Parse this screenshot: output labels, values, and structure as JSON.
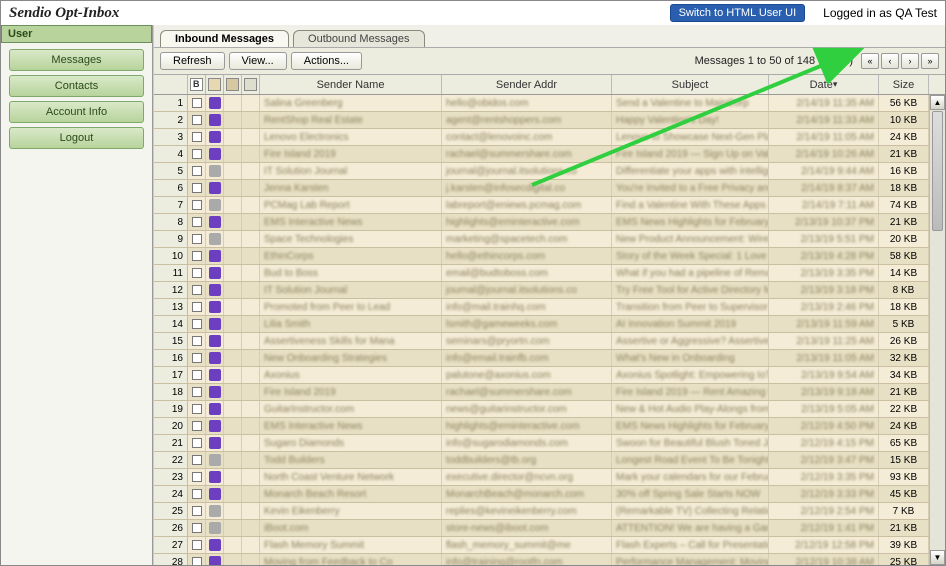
{
  "header": {
    "title": "Sendio Opt-Inbox",
    "switch_label": "Switch to HTML User UI",
    "logged_label": "Logged in as QA Test"
  },
  "sidebar": {
    "title": "User",
    "items": [
      "Messages",
      "Contacts",
      "Account Info",
      "Logout"
    ]
  },
  "tabs": {
    "items": [
      {
        "label": "Inbound Messages",
        "active": true
      },
      {
        "label": "Outbound Messages",
        "active": false
      }
    ]
  },
  "toolbar": {
    "refresh": "Refresh",
    "view": "View...",
    "actions": "Actions...",
    "status": "Messages 1 to 50 of 148 (found)",
    "nav_icons": [
      "first-page-icon",
      "prev-page-icon",
      "next-page-icon",
      "last-page-icon"
    ]
  },
  "columns": {
    "idx": "",
    "chk_icon": "checkbox-header-icon",
    "sender_name": "Sender Name",
    "sender_addr": "Sender Addr",
    "subject": "Subject",
    "date": "Date",
    "size": "Size"
  },
  "rows": [
    {
      "idx": 1,
      "name": "Salina Greenberg",
      "addr": "hello@obidos.com",
      "subj": "Send a Valentine to MainCorp",
      "date": "2/14/19 11:35 AM",
      "size": "56 KB",
      "icon": "purple"
    },
    {
      "idx": 2,
      "name": "RentShop Real Estate",
      "addr": "agent@rentshoppers.com",
      "subj": "Happy Valentine's Day!",
      "date": "2/14/19 11:33 AM",
      "size": "10 KB",
      "icon": "purple"
    },
    {
      "idx": 3,
      "name": "Lenovo Electronics",
      "addr": "contact@lenovoinc.com",
      "subj": "Lenovo to Showcase Next-Gen Platforms for New",
      "date": "2/14/19 11:05 AM",
      "size": "24 KB",
      "icon": "purple"
    },
    {
      "idx": 4,
      "name": "Fire Island 2019",
      "addr": "rachael@summershare.com",
      "subj": "Fire Island 2019 — Sign Up on Valentine's Day &",
      "date": "2/14/19 10:26 AM",
      "size": "21 KB",
      "icon": "purple"
    },
    {
      "idx": 5,
      "name": "IT Solution Journal",
      "addr": "journal@journal.itsolutions.co",
      "subj": "Differentiate your apps with intelligent technolo",
      "date": "2/14/19 9:44 AM",
      "size": "16 KB",
      "icon": "gray"
    },
    {
      "idx": 6,
      "name": "Jenna Karsten",
      "addr": "j.karsten@infosecdigital.co",
      "subj": "You're Invited to a Free Privacy and Security Onl",
      "date": "2/14/19 8:37 AM",
      "size": "18 KB",
      "icon": "purple"
    },
    {
      "idx": 7,
      "name": "PCMag Lab Report",
      "addr": "labreport@eniews.pcmag.com",
      "subj": "Find a Valentine With These Apps / Get Organized",
      "date": "2/14/19 7:11 AM",
      "size": "74 KB",
      "icon": "gray"
    },
    {
      "idx": 8,
      "name": "EMS Interactive News",
      "addr": "highlights@eminteractive.com",
      "subj": "EMS News Highlights for February 13, 2019",
      "date": "2/13/19 10:37 PM",
      "size": "21 KB",
      "icon": "purple"
    },
    {
      "idx": 9,
      "name": "Space Technologies",
      "addr": "marketing@spacetech.com",
      "subj": "New Product Announcement: Wireless WiFi NIC",
      "date": "2/13/19 5:51 PM",
      "size": "20 KB",
      "icon": "gray"
    },
    {
      "idx": 10,
      "name": "EthinCorps",
      "addr": "hello@ethincorps.com",
      "subj": "Story of the Week Special: 1 Love Letter 4 Lemo",
      "date": "2/13/19 4:28 PM",
      "size": "58 KB",
      "icon": "purple"
    },
    {
      "idx": 11,
      "name": "Bud to Boss",
      "addr": "email@budtoboss.com",
      "subj": "What if you had a pipeline of Remarkable Leader",
      "date": "2/13/19 3:35 PM",
      "size": "14 KB",
      "icon": "purple"
    },
    {
      "idx": 12,
      "name": "IT Solution Journal",
      "addr": "journal@journal.itsolutions.co",
      "subj": "Try Free Tool for Active Directory Monitoring",
      "date": "2/13/19 3:18 PM",
      "size": "8 KB",
      "icon": "purple"
    },
    {
      "idx": 13,
      "name": "Promoted from Peer to Lead",
      "addr": "info@mail.trainhq.com",
      "subj": "Transition from Peer to Supervisor",
      "date": "2/13/19 2:46 PM",
      "size": "18 KB",
      "icon": "purple"
    },
    {
      "idx": 14,
      "name": "Lilia Smith",
      "addr": "lsmith@gameweeks.com",
      "subj": "AI Innovation Summit 2019",
      "date": "2/13/19 11:59 AM",
      "size": "5 KB",
      "icon": "purple"
    },
    {
      "idx": 15,
      "name": "Assertiveness Skills for Mana",
      "addr": "seminars@pryortn.com",
      "subj": "Assertive or Aggressive? Assertiveness Negotiati",
      "date": "2/13/19 11:25 AM",
      "size": "26 KB",
      "icon": "purple"
    },
    {
      "idx": 16,
      "name": "New Onboarding Strategies",
      "addr": "info@email.trainfb.com",
      "subj": "What's New in Onboarding",
      "date": "2/13/19 11:05 AM",
      "size": "32 KB",
      "icon": "purple"
    },
    {
      "idx": 17,
      "name": "Axonius",
      "addr": "palutone@axonius.com",
      "subj": "Axonius Spotlight: Empowering IoT Innovation",
      "date": "2/13/19 9:54 AM",
      "size": "34 KB",
      "icon": "purple"
    },
    {
      "idx": 18,
      "name": "Fire Island 2019",
      "addr": "rachael@summershare.com",
      "subj": "Fire Island 2019 — Rent Amazing Houses in Sea",
      "date": "2/13/19 9:18 AM",
      "size": "21 KB",
      "icon": "purple"
    },
    {
      "idx": 19,
      "name": "GuitarInstructor.com",
      "addr": "news@guitarinstructor.com",
      "subj": "New & Hot Audio Play-Alongs from Mark Moore,",
      "date": "2/13/19 5:05 AM",
      "size": "22 KB",
      "icon": "purple"
    },
    {
      "idx": 20,
      "name": "EMS Interactive News",
      "addr": "highlights@eminteractive.com",
      "subj": "EMS News Highlights for February 12, 2019",
      "date": "2/12/19 4:50 PM",
      "size": "24 KB",
      "icon": "purple"
    },
    {
      "idx": 21,
      "name": "Sugaro Diamonds",
      "addr": "info@sugarodiamonds.com",
      "subj": "Swoon for Beautiful Blush Toned Jewels this V",
      "date": "2/12/19 4:15 PM",
      "size": "65 KB",
      "icon": "purple"
    },
    {
      "idx": 22,
      "name": "Todd Builders",
      "addr": "toddbuilders@tb.org",
      "subj": "Longest Road Event To Be Tonight",
      "date": "2/12/19 3:47 PM",
      "size": "15 KB",
      "icon": "gray"
    },
    {
      "idx": 23,
      "name": "North Coast Venture Network",
      "addr": "executive.director@ncvn.org",
      "subj": "Mark your calendars for our February Events",
      "date": "2/12/19 3:35 PM",
      "size": "93 KB",
      "icon": "purple"
    },
    {
      "idx": 24,
      "name": "Monarch Beach Resort",
      "addr": "MonarchBeach@monarch.com",
      "subj": "30% off Spring Sale Starts NOW",
      "date": "2/12/19 3:33 PM",
      "size": "45 KB",
      "icon": "purple"
    },
    {
      "idx": 25,
      "name": "Kevin Eikenberry",
      "addr": "replies@kevineikenberry.com",
      "subj": "(Remarkable TV) Collecting Relationships",
      "date": "2/12/19 2:54 PM",
      "size": "7 KB",
      "icon": "gray"
    },
    {
      "idx": 26,
      "name": "iBoot.com",
      "addr": "store-news@iboot.com",
      "subj": "ATTENTION! We are having a Garage Sale! Don't",
      "date": "2/12/19 1:41 PM",
      "size": "21 KB",
      "icon": "gray"
    },
    {
      "idx": 27,
      "name": "Flash Memory Summit",
      "addr": "flash_memory_summit@me",
      "subj": "Flash Experts – Call for Presentations for 2019 is",
      "date": "2/12/19 12:58 PM",
      "size": "39 KB",
      "icon": "purple"
    },
    {
      "idx": 28,
      "name": "Moving from Feedback to Co",
      "addr": "info@training@rootfn.com",
      "subj": "Performance Management: Moving from Feedba",
      "date": "2/12/19 10:38 AM",
      "size": "25 KB",
      "icon": "purple"
    }
  ]
}
